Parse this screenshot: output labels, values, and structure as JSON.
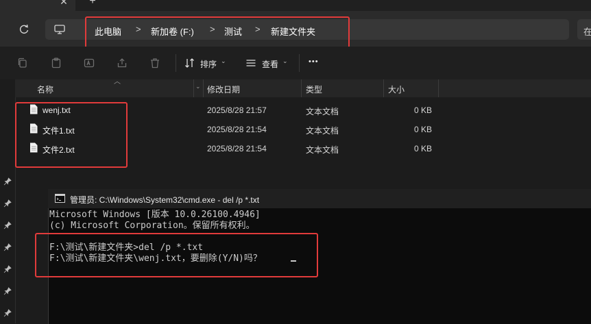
{
  "tabbar": {
    "new_tab_label": "+",
    "close_label": "✕"
  },
  "address": {
    "crumbs": [
      "此电脑",
      "新加卷 (F:)",
      "测试",
      "新建文件夹"
    ],
    "separator": ">",
    "search_partial": "在"
  },
  "toolbar": {
    "sort_label": "排序",
    "view_label": "查看",
    "more_label": "•••"
  },
  "columns": {
    "name": "名称",
    "modified": "修改日期",
    "type": "类型",
    "size": "大小"
  },
  "files": [
    {
      "name": "wenj.txt",
      "modified": "2025/8/28 21:57",
      "type": "文本文档",
      "size": "0 KB"
    },
    {
      "name": "文件1.txt",
      "modified": "2025/8/28 21:54",
      "type": "文本文档",
      "size": "0 KB"
    },
    {
      "name": "文件2.txt",
      "modified": "2025/8/28 21:54",
      "type": "文本文档",
      "size": "0 KB"
    }
  ],
  "cmd": {
    "title": "管理员: C:\\Windows\\System32\\cmd.exe - del  /p *.txt",
    "lines": [
      "Microsoft Windows [版本 10.0.26100.4946]",
      "(c) Microsoft Corporation。保留所有权利。",
      "",
      "F:\\测试\\新建文件夹>del /p *.txt",
      "F:\\测试\\新建文件夹\\wenj.txt，要删除(Y/N)吗？"
    ]
  },
  "colors": {
    "highlight": "#e23b3b",
    "terminal_bg": "#0c0c0c",
    "explorer_bg": "#1c1c1c"
  }
}
